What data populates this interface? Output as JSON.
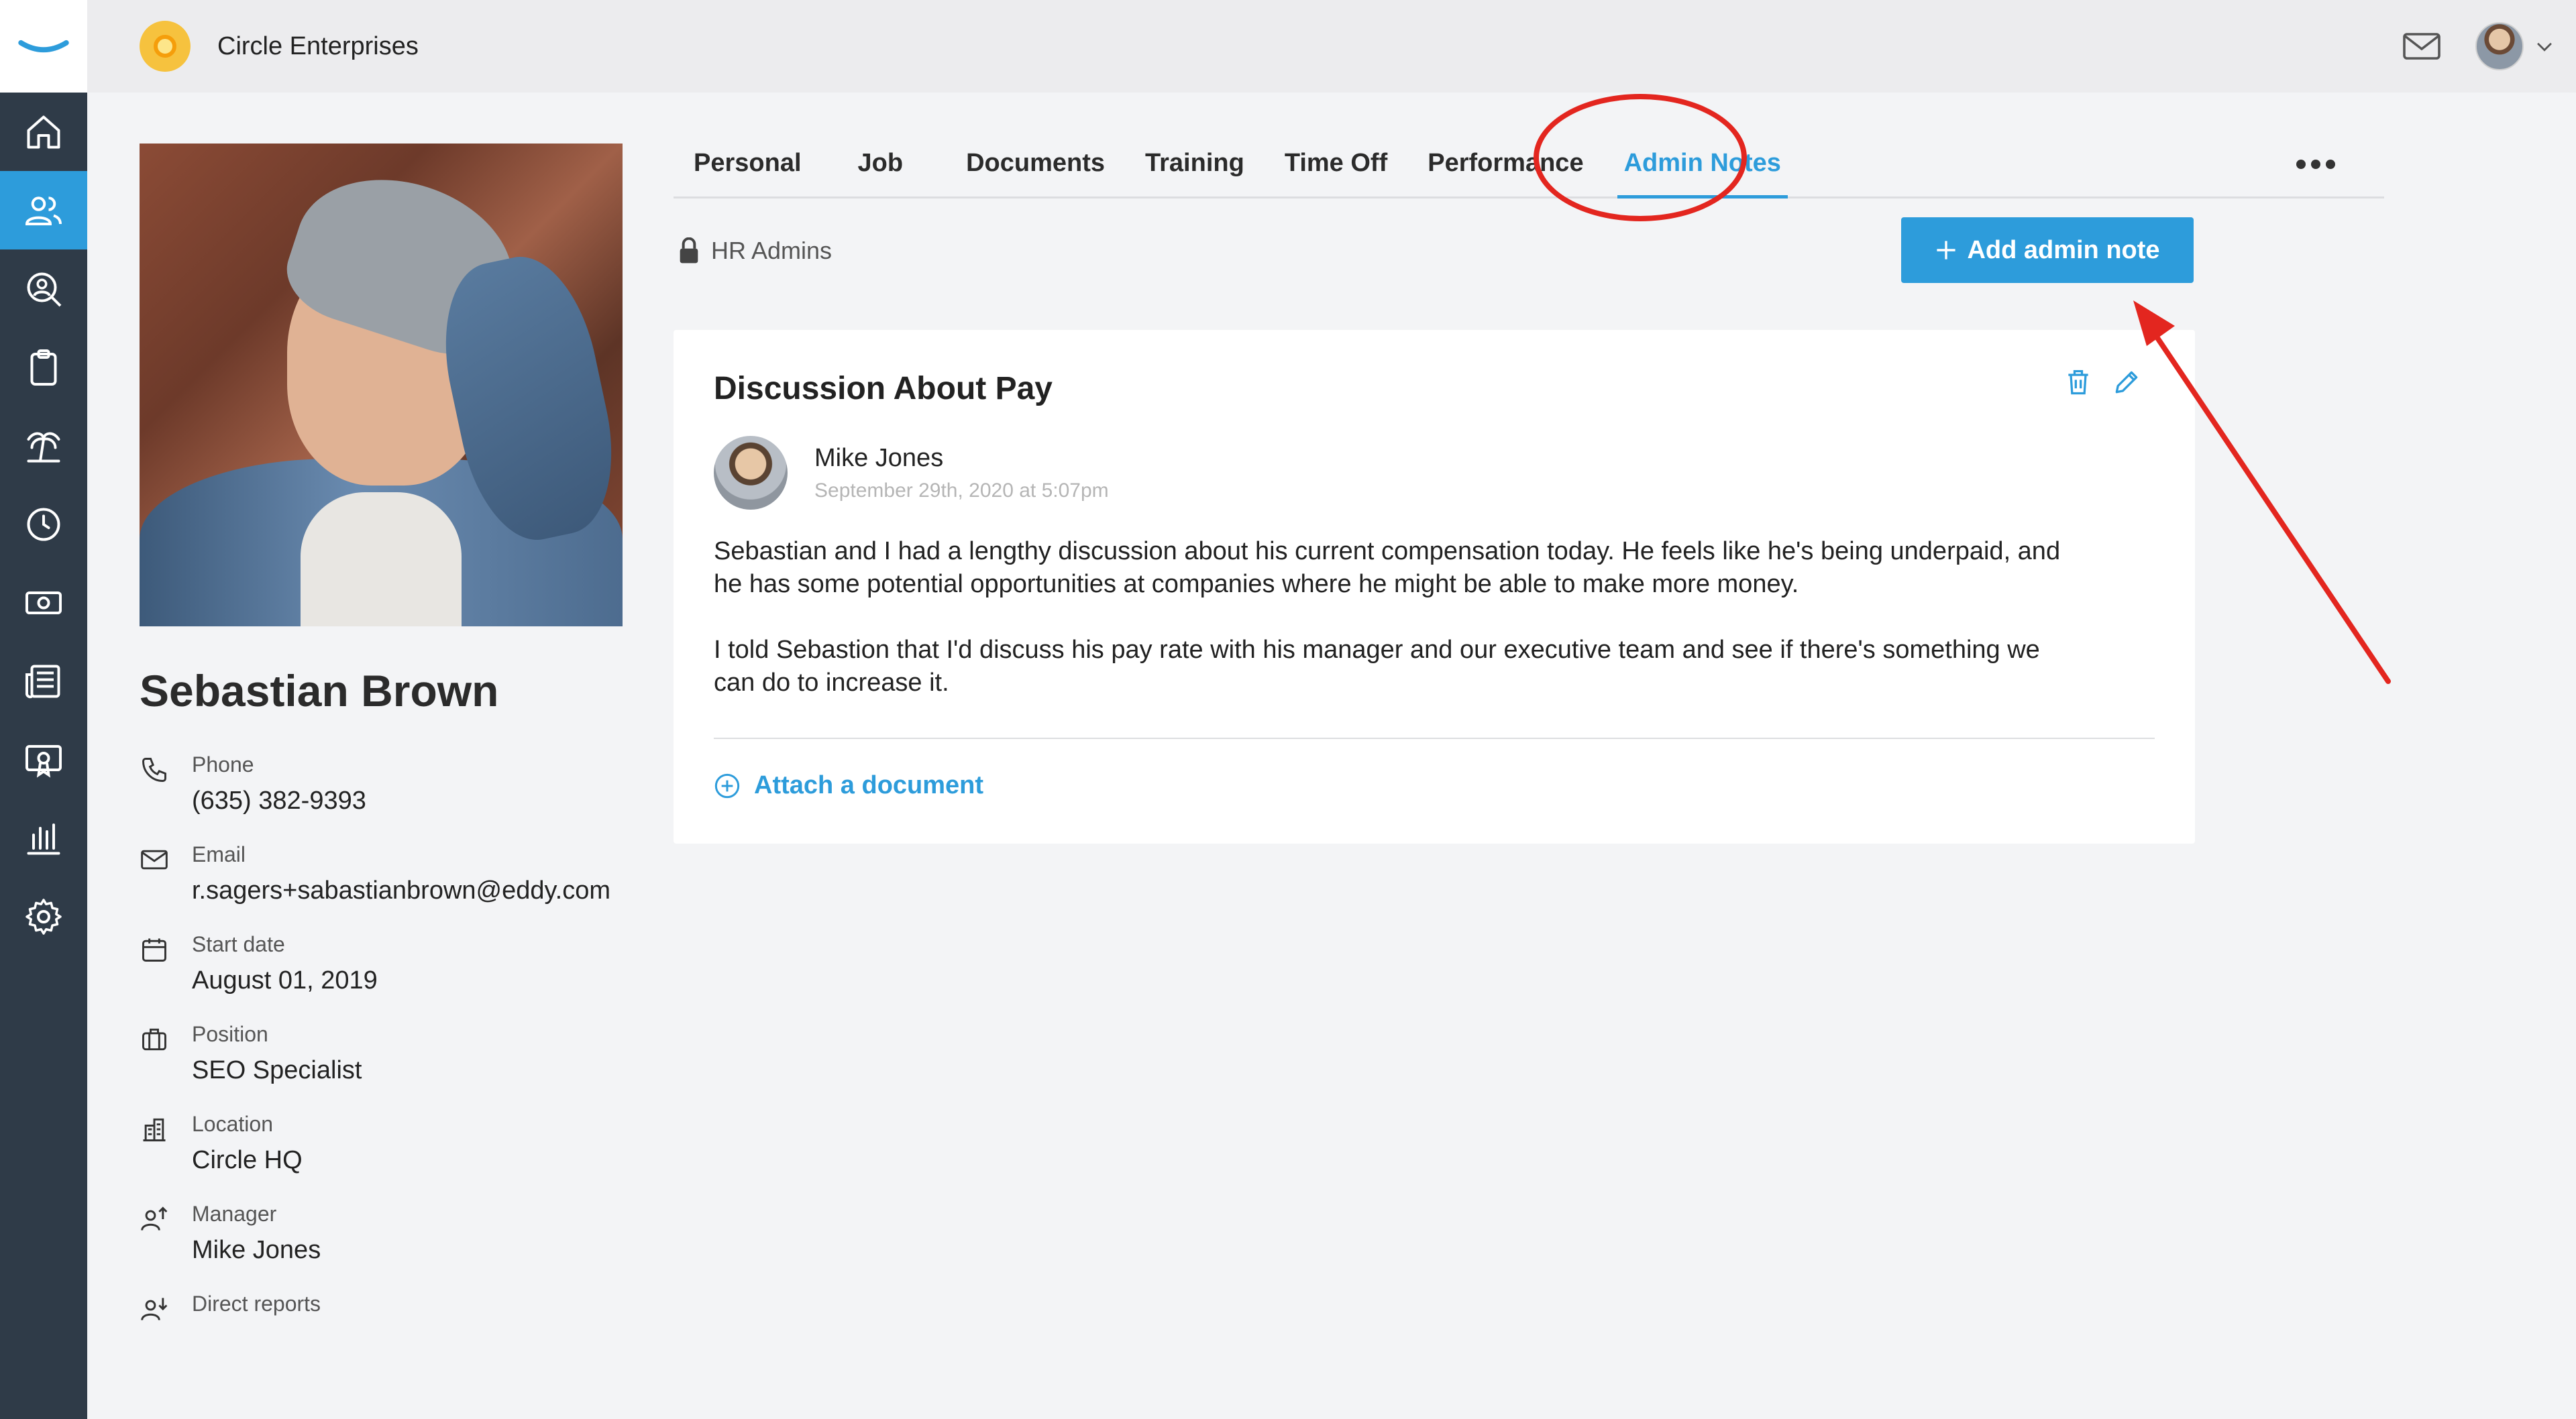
{
  "topbar": {
    "company_name": "Circle Enterprises",
    "mail_icon": "mail-icon",
    "user_avatar": "avatar"
  },
  "sidebar": {
    "items": [
      {
        "icon": "home-icon",
        "active": false
      },
      {
        "icon": "people-icon",
        "active": true
      },
      {
        "icon": "search-people-icon",
        "active": false
      },
      {
        "icon": "clipboard-icon",
        "active": false
      },
      {
        "icon": "palm-tree-icon",
        "active": false
      },
      {
        "icon": "clock-icon",
        "active": false
      },
      {
        "icon": "money-icon",
        "active": false
      },
      {
        "icon": "newspaper-icon",
        "active": false
      },
      {
        "icon": "certificate-icon",
        "active": false
      },
      {
        "icon": "chart-icon",
        "active": false
      },
      {
        "icon": "gear-icon",
        "active": false
      }
    ]
  },
  "profile": {
    "name": "Sebastian Brown",
    "fields": {
      "phone": {
        "label": "Phone",
        "value": "(635) 382-9393"
      },
      "email": {
        "label": "Email",
        "value": "r.sagers+sabastianbrown@eddy.com"
      },
      "start_date": {
        "label": "Start date",
        "value": "August 01, 2019"
      },
      "position": {
        "label": "Position",
        "value": "SEO Specialist"
      },
      "location": {
        "label": "Location",
        "value": "Circle HQ"
      },
      "manager": {
        "label": "Manager",
        "value": "Mike Jones"
      },
      "direct_reports": {
        "label": "Direct reports",
        "value": ""
      }
    }
  },
  "tabs": [
    {
      "label": "Personal",
      "active": false
    },
    {
      "label": "Job",
      "active": false
    },
    {
      "label": "Documents",
      "active": false
    },
    {
      "label": "Training",
      "active": false
    },
    {
      "label": "Time Off",
      "active": false
    },
    {
      "label": "Performance",
      "active": false
    },
    {
      "label": "Admin Notes",
      "active": true
    }
  ],
  "subbar": {
    "privacy_label": "HR Admins",
    "add_button_label": "Add admin note"
  },
  "note": {
    "title": "Discussion About Pay",
    "author": "Mike Jones",
    "date": "September 29th, 2020 at 5:07pm",
    "paragraphs": [
      "Sebastian and I had a lengthy discussion about his current compensation today. He feels like he's being underpaid, and he has some potential opportunities at companies where he might be able to make more money.",
      "I told Sebastion that I'd discuss his pay rate with his manager and our executive team and see if there's something we can do to increase it."
    ],
    "attach_label": "Attach a document"
  },
  "colors": {
    "accent": "#2d9cdb",
    "sidebar_bg": "#2f3b48",
    "annotation": "#e3261f",
    "page_bg": "#f3f4f6"
  }
}
